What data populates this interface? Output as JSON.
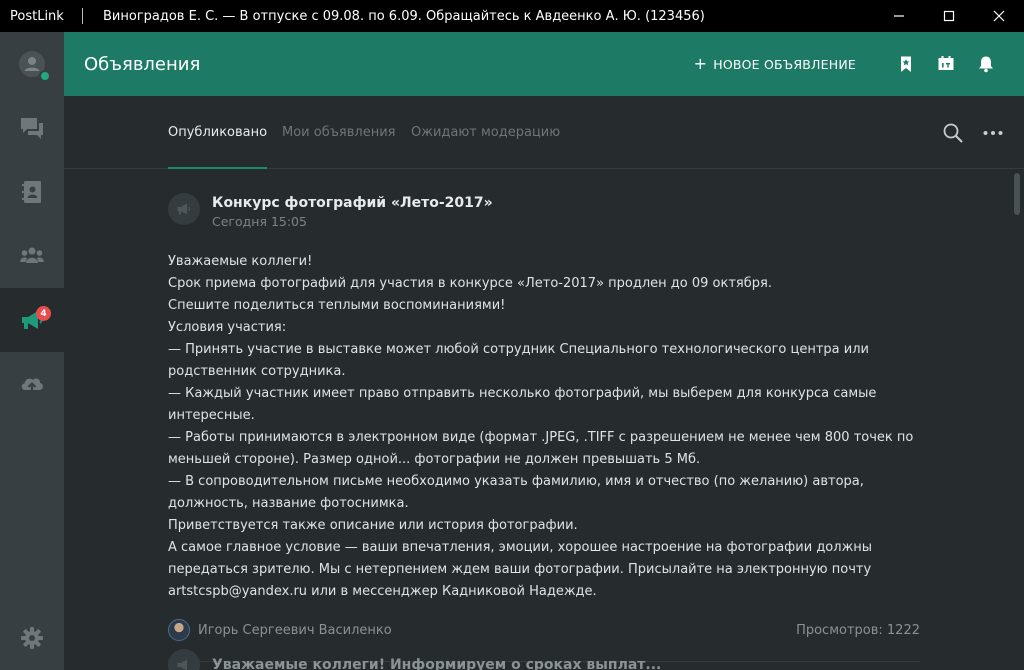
{
  "window": {
    "app_name": "PostLink",
    "status": "Виноградов Е. С. — В отпуске с 09.08. по 6.09. Обращайтесь к Авдеенко А. Ю. (123456)"
  },
  "rail": {
    "items": [
      {
        "name": "profile",
        "icon": "user-avatar-icon"
      },
      {
        "name": "chats",
        "icon": "chat-bubbles-icon"
      },
      {
        "name": "contacts",
        "icon": "address-book-icon"
      },
      {
        "name": "groups",
        "icon": "group-icon"
      },
      {
        "name": "announcements",
        "icon": "megaphone-icon",
        "badge": "4",
        "active": true
      },
      {
        "name": "uploads",
        "icon": "cloud-upload-icon"
      },
      {
        "name": "settings",
        "icon": "gear-icon"
      }
    ]
  },
  "header": {
    "title": "Объявления",
    "new_label": "НОВОЕ ОБЪЯВЛЕНИЕ",
    "icons": [
      "bookmark-icon",
      "calendar-icon",
      "bell-icon"
    ]
  },
  "tabs": [
    {
      "label": "Опубликовано",
      "active": true
    },
    {
      "label": "Мои объявления",
      "active": false
    },
    {
      "label": "Ожидают модерацию",
      "active": false
    }
  ],
  "post": {
    "title": "Конкурс фотографий «Лето-2017»",
    "time": "Сегодня 15:05",
    "body": [
      "Уважаемые коллеги!",
      "Срок приема фотографий для участия в конкурсе «Лето-2017» продлен до 09 октября.",
      "Спешите поделиться теплыми воспоминаниями!",
      "Условия участия:",
      "— Принять участие в выставке может любой сотрудник Специального технологического центра или родственник сотрудника.",
      "— Каждый участник имеет право отправить несколько фотографий, мы выберем для конкурса самые интересные.",
      "— Работы принимаются в электронном виде (формат .JPEG, .TIFF с разрешением не менее чем 800 точек по меньшей стороне). Размер одной... фотографии не должен превышать 5 Мб.",
      "— В сопроводительном письме необходимо указать фамилию, имя и отчество (по желанию) автора, должность, название фотоснимка.",
      "Приветствуется также описание или история фотографии.",
      "А самое главное условие — ваши впечатления, эмоции, хорошее настроение на фотографии должны передаться зрителю. Мы с нетерпением ждем ваши фотографии. Присылайте на электронную почту artstcspb@yandex.ru или в мессенджер Кадниковой Надежде."
    ],
    "author": "Игорь Сергеевич Василенко",
    "views": "Просмотров: 1222"
  },
  "post2": {
    "title": "Уважаемые коллеги! Информируем о сроках выплат..."
  },
  "colors": {
    "header": "#1d7a64",
    "rail": "#383f42",
    "content": "#262b2d",
    "badge": "#e84c4c"
  }
}
